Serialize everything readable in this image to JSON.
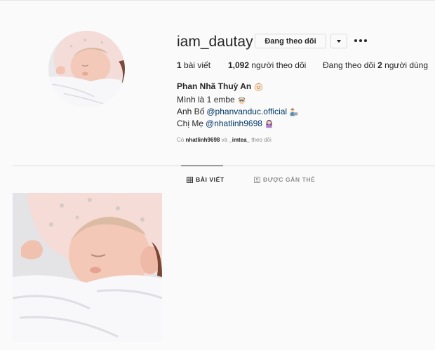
{
  "profile": {
    "username": "iam_dautay",
    "following_button_label": "Đang theo dõi",
    "full_name": "Phan Nhã Thuỳ An",
    "stats": {
      "posts_count": "1",
      "posts_label": " bài viết",
      "followers_count": "1,092",
      "followers_label": " người theo dõi",
      "following_prefix": "Đang theo dõi ",
      "following_count": "2",
      "following_label": " người dùng"
    },
    "bio": {
      "line1": "Mình là 1 embe",
      "line2_prefix": "Anh Bố ",
      "line2_mention": "@phanvanduc.official",
      "line3_prefix": "Chị Mẹ ",
      "line3_mention": "@nhatlinh9698"
    },
    "followed_by": {
      "prefix": "Có ",
      "user1": "nhatlinh9698",
      "conj": " và ",
      "user2": "_imtea_",
      "suffix": " theo dõi"
    }
  },
  "tabs": {
    "posts_label": "BÀI VIẾT",
    "tagged_label": "ĐƯỢC GẮN THẺ"
  },
  "colors": {
    "accent_link": "#00376b",
    "muted": "#8e8e8e",
    "text": "#262626",
    "background": "#fafafa"
  },
  "icons": [
    "baby-emoji-icon",
    "man-emoji-icon",
    "man-laptop-emoji-icon",
    "woman-emoji-icon",
    "grid-icon",
    "tag-icon",
    "caret-down-icon",
    "more-options-icon"
  ]
}
